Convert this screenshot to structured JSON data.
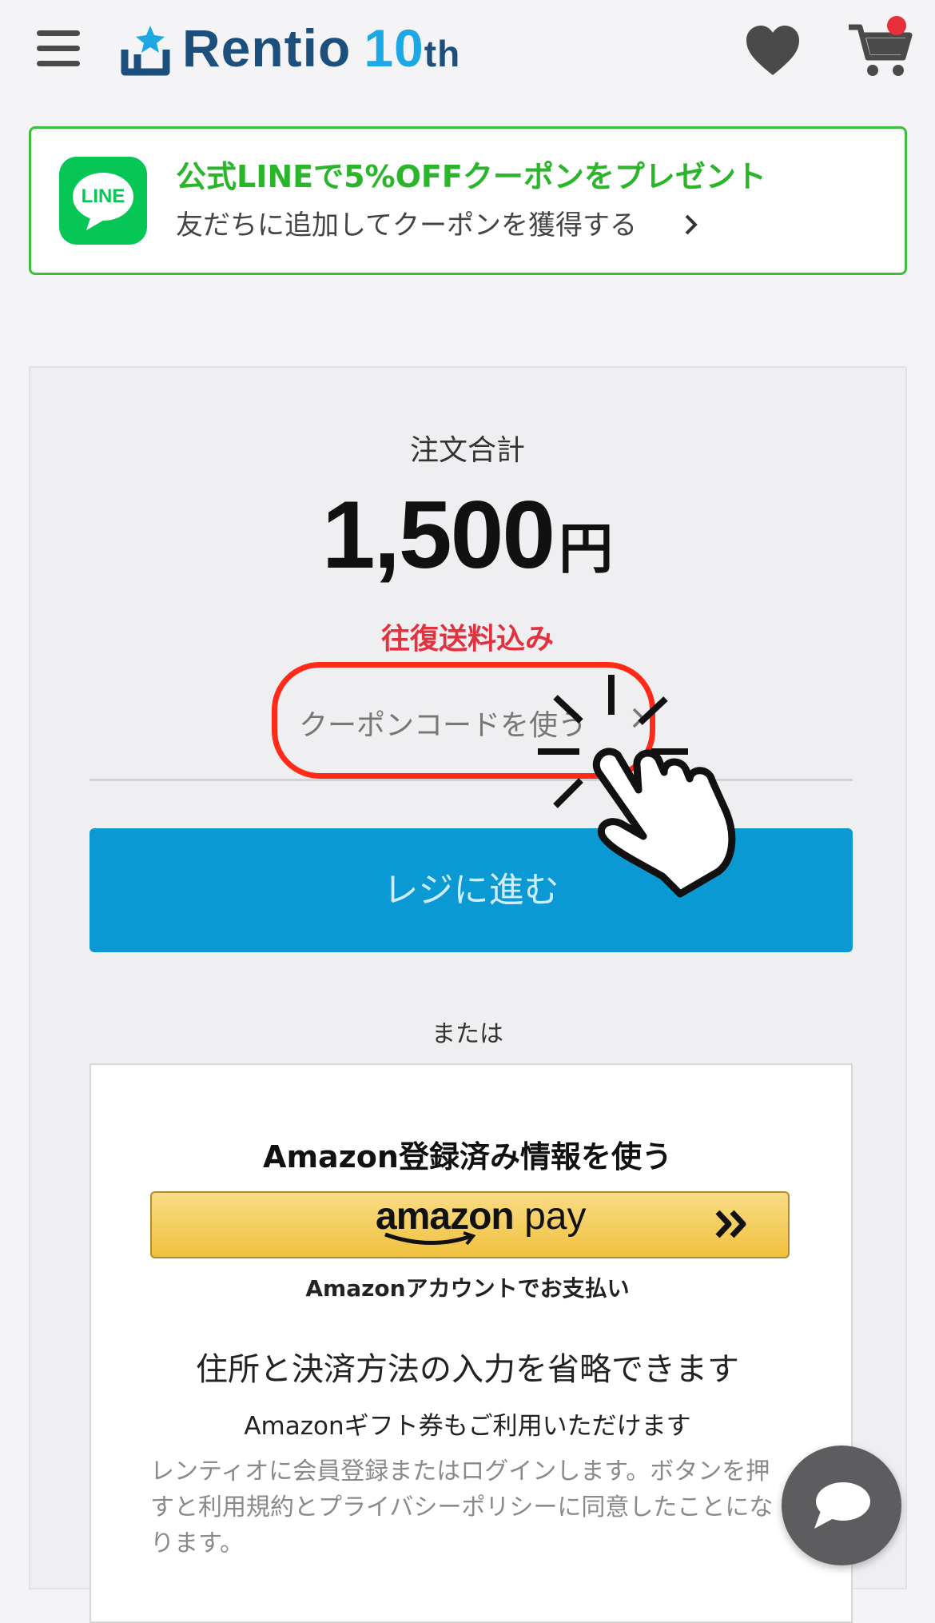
{
  "header": {
    "logo_name": "Rentio",
    "logo_badge": "10",
    "logo_badge_suffix": "th",
    "menu_icon": "hamburger-icon",
    "favorites_icon": "heart-icon",
    "cart_icon": "cart-icon"
  },
  "line_banner": {
    "logo_text": "LINE",
    "title": "公式LINEで5%OFFクーポンをプレゼント",
    "subtitle": "友だちに追加してクーポンを獲得する",
    "title_color": "#2bb52b",
    "brand_color": "#06c755"
  },
  "order": {
    "total_label": "注文合計",
    "total_amount": "1,500",
    "currency": "円",
    "shipping_note": "往復送料込み",
    "coupon_link": "クーポンコードを使う",
    "checkout_button": "レジに進む",
    "or_label": "または",
    "accent_color": "#0a99d2",
    "highlight_color": "#ff2a18"
  },
  "amazon": {
    "title": "Amazon登録済み情報を使う",
    "pay_logo_bold": "amazon",
    "pay_logo_light": "pay",
    "pay_caption": "Amazonアカウントでお支払い",
    "lead": "住所と決済方法の入力を省略できます",
    "gift_note": "Amazonギフト券もご利用いただけます",
    "terms_note": "レンティオに会員登録またはログインします。ボタンを押すと利用規約とプライバシーポリシーに同意したことになります。"
  },
  "chat": {
    "icon": "chat-bubble-icon"
  }
}
